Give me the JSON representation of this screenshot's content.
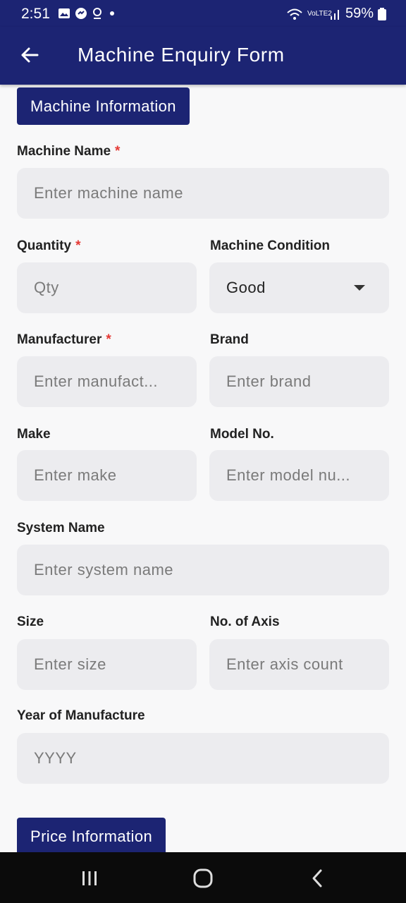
{
  "status_bar": {
    "time": "2:51",
    "left_icons": [
      "gallery-icon",
      "messenger-icon",
      "location-icon",
      "dot-icon"
    ],
    "network": "VoLTE2",
    "battery": "59%"
  },
  "app_bar": {
    "title": "Machine Enquiry Form",
    "back_icon": "arrow-left-icon"
  },
  "sections": {
    "machine_info": "Machine Information",
    "price_info": "Price Information"
  },
  "form": {
    "machine_name": {
      "label": "Machine Name",
      "required": "*",
      "placeholder": "Enter machine name"
    },
    "quantity": {
      "label": "Quantity",
      "required": "*",
      "placeholder": "Qty"
    },
    "machine_condition": {
      "label": "Machine Condition",
      "value": "Good"
    },
    "manufacturer": {
      "label": "Manufacturer",
      "required": "*",
      "placeholder": "Enter manufact..."
    },
    "brand": {
      "label": "Brand",
      "placeholder": "Enter brand"
    },
    "make": {
      "label": "Make",
      "placeholder": "Enter make"
    },
    "model_no": {
      "label": "Model No.",
      "placeholder": "Enter model nu..."
    },
    "system_name": {
      "label": "System Name",
      "placeholder": "Enter system name"
    },
    "size": {
      "label": "Size",
      "placeholder": "Enter size"
    },
    "no_of_axis": {
      "label": "No. of Axis",
      "placeholder": "Enter axis count"
    },
    "year": {
      "label": "Year of Manufacture",
      "placeholder": "YYYY"
    }
  },
  "nav_bar": {
    "icons": [
      "recents-icon",
      "home-icon",
      "back-icon"
    ]
  },
  "colors": {
    "primary": "#1c2473",
    "required": "#e53935",
    "field_bg": "#ececef"
  }
}
